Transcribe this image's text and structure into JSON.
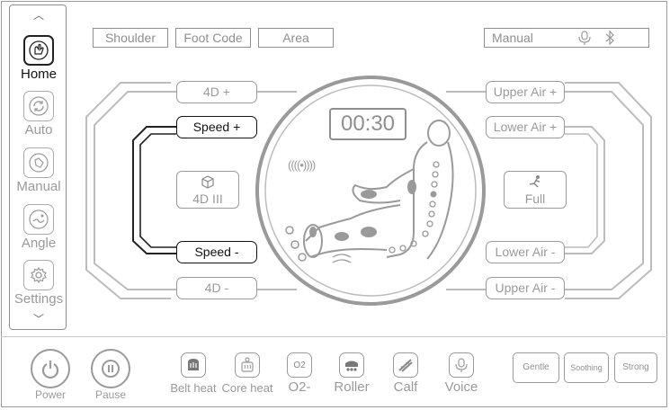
{
  "sidebar": {
    "items": [
      {
        "label": "Home",
        "icon": "hand-massage-icon",
        "active": true
      },
      {
        "label": "Auto",
        "icon": "auto-cycle-icon",
        "active": false
      },
      {
        "label": "Manual",
        "icon": "hand-press-icon",
        "active": false
      },
      {
        "label": "Angle",
        "icon": "recline-angle-icon",
        "active": false
      },
      {
        "label": "Settings",
        "icon": "gear-icon",
        "active": false
      }
    ]
  },
  "top": {
    "shoulder": "Shoulder",
    "foot_code": "Foot Code",
    "area": "Area",
    "mode": "Manual",
    "status_icons": [
      "voice-icon",
      "bluetooth-icon"
    ]
  },
  "left_controls": {
    "fourd_plus": "4D +",
    "speed_plus": "Speed +",
    "mode_label": "4D III",
    "speed_minus": "Speed -",
    "fourd_minus": "4D -"
  },
  "center": {
    "timer": "00:30",
    "wave": "((((•))))"
  },
  "right_controls": {
    "upper_air_plus": "Upper Air +",
    "lower_air_plus": "Lower Air +",
    "mode_label": "Full",
    "lower_air_minus": "Lower Air -",
    "upper_air_minus": "Upper Air -"
  },
  "bottom": {
    "power": "Power",
    "pause": "Pause",
    "belt_heat": "Belt heat",
    "core_heat": "Core heat",
    "o2": "O2-",
    "o2_icon_text": "O2",
    "roller": "Roller",
    "calf": "Calf",
    "voice": "Voice",
    "gentle": "Gentle",
    "soothing": "Soothing",
    "strong": "Strong"
  }
}
